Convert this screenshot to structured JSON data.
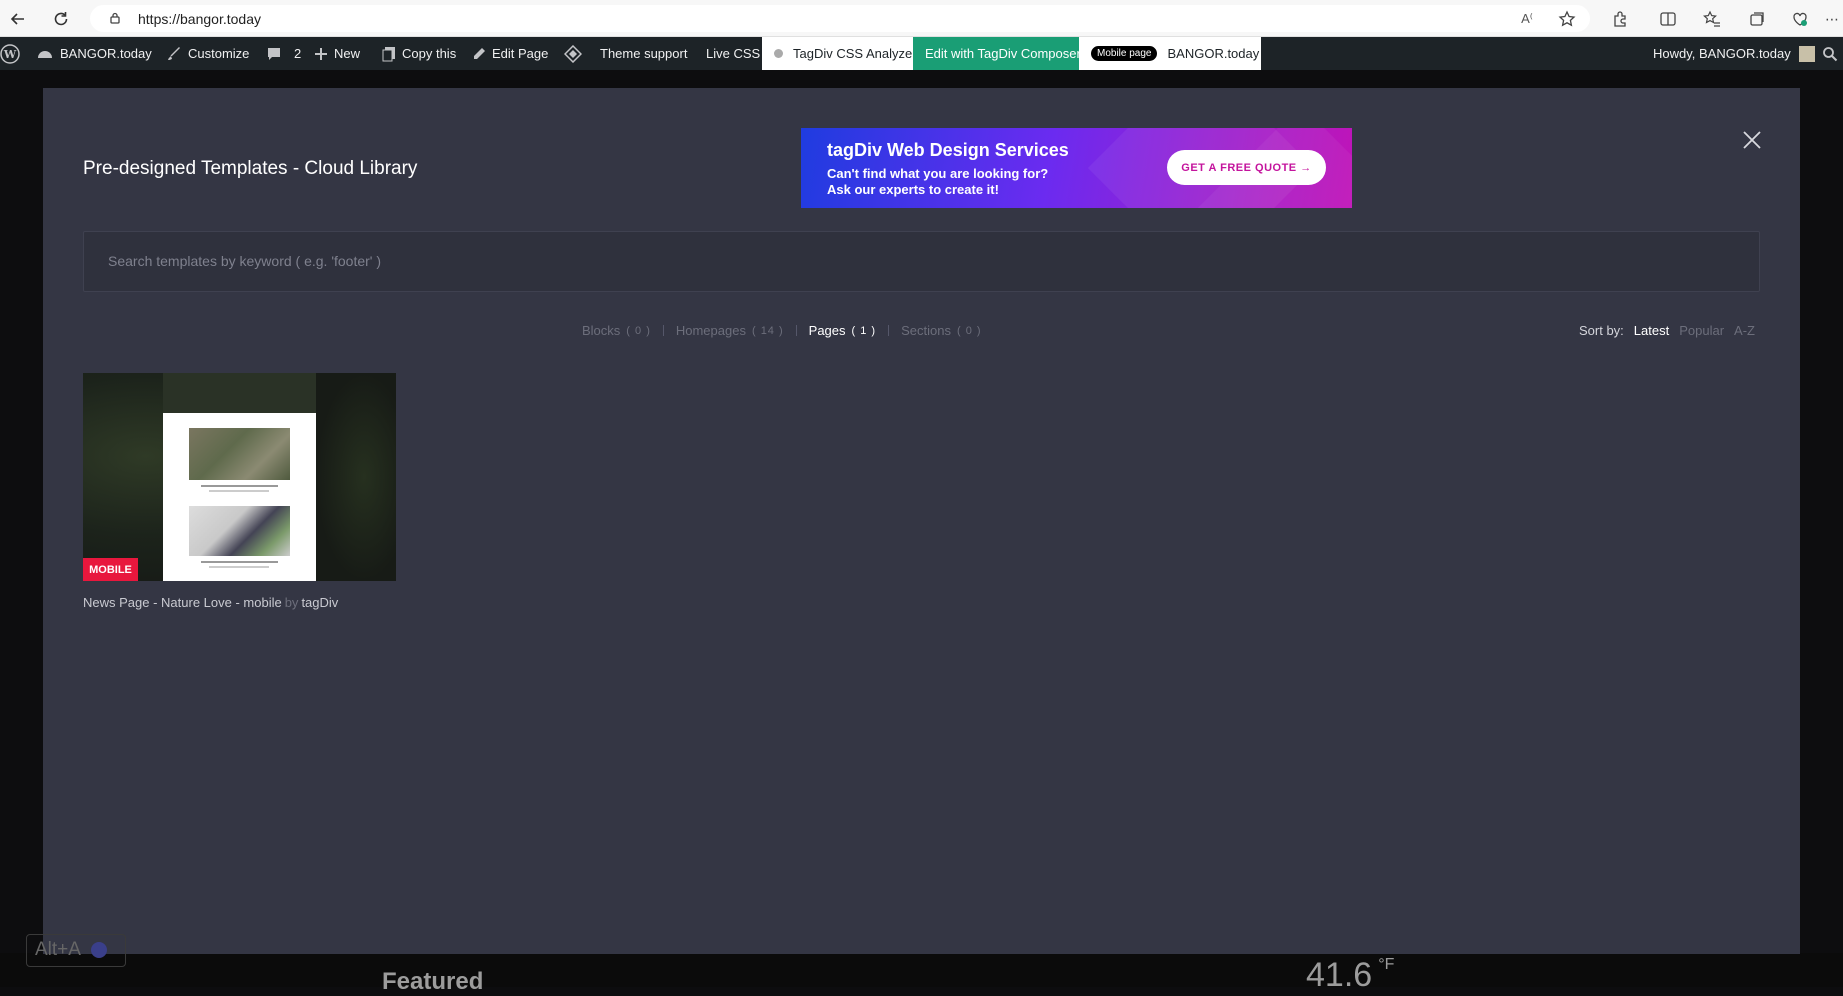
{
  "browser": {
    "url": "https://bangor.today"
  },
  "wp_admin_bar": {
    "site_name": "BANGOR.today",
    "customize": "Customize",
    "comments_count": "2",
    "new": "New",
    "copy_this": "Copy this",
    "edit_page": "Edit Page",
    "theme_support": "Theme support",
    "live_css": "Live CSS",
    "css_analyzer": "TagDiv CSS Analyzer",
    "edit_composer": "Edit with TagDiv Composer",
    "mobile_pill": "Mobile page",
    "mobile_site": "BANGOR.today",
    "howdy": "Howdy, BANGOR.today"
  },
  "modal": {
    "title": "Pre-designed Templates - Cloud Library",
    "promo": {
      "title": "tagDiv Web Design Services",
      "subtitle_line1": "Can't find what you are looking for?",
      "subtitle_line2": "Ask our experts to create it!",
      "button": "GET A FREE QUOTE →"
    },
    "search_placeholder": "Search templates by keyword ( e.g. 'footer' )",
    "filters": [
      {
        "label": "Blocks",
        "count": "( 0 )",
        "active": false
      },
      {
        "label": "Homepages",
        "count": "( 14 )",
        "active": false
      },
      {
        "label": "Pages",
        "count": "( 1 )",
        "active": true
      },
      {
        "label": "Sections",
        "count": "( 0 )",
        "active": false
      }
    ],
    "sort": {
      "label": "Sort by:",
      "options": [
        "Latest",
        "Popular",
        "A-Z"
      ],
      "active": "Latest"
    },
    "templates": [
      {
        "badge": "MOBILE",
        "name": "News Page - Nature Love - mobile",
        "by": "by",
        "author": "tagDiv"
      }
    ]
  },
  "background": {
    "featured": "Featured",
    "temperature": "41.6",
    "temp_unit": "°F",
    "shortcut": "Alt+A"
  },
  "colors": {
    "modal_bg": "#343644",
    "accent_badge": "#e8173d",
    "composer_green": "#1a9e75"
  }
}
